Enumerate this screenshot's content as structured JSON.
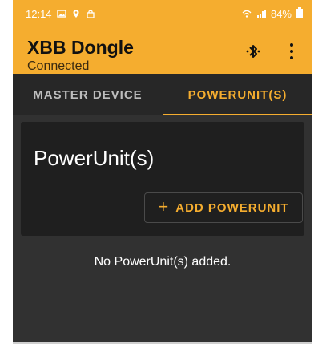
{
  "status_bar": {
    "time": "12:14",
    "battery": "84%"
  },
  "app_bar": {
    "title": "XBB Dongle",
    "subtitle": "Connected"
  },
  "tabs": [
    {
      "label": "MASTER DEVICE",
      "active": false
    },
    {
      "label": "POWERUNIT(S)",
      "active": true
    }
  ],
  "card": {
    "title": "PowerUnit(s)",
    "add_button_label": "ADD POWERUNIT",
    "add_button_icon": "+"
  },
  "empty_state": {
    "message": "No PowerUnit(s) added."
  },
  "colors": {
    "accent": "#f5ad2f",
    "background": "#313131",
    "card": "#1f1f1f",
    "tab_bar": "#272727"
  }
}
